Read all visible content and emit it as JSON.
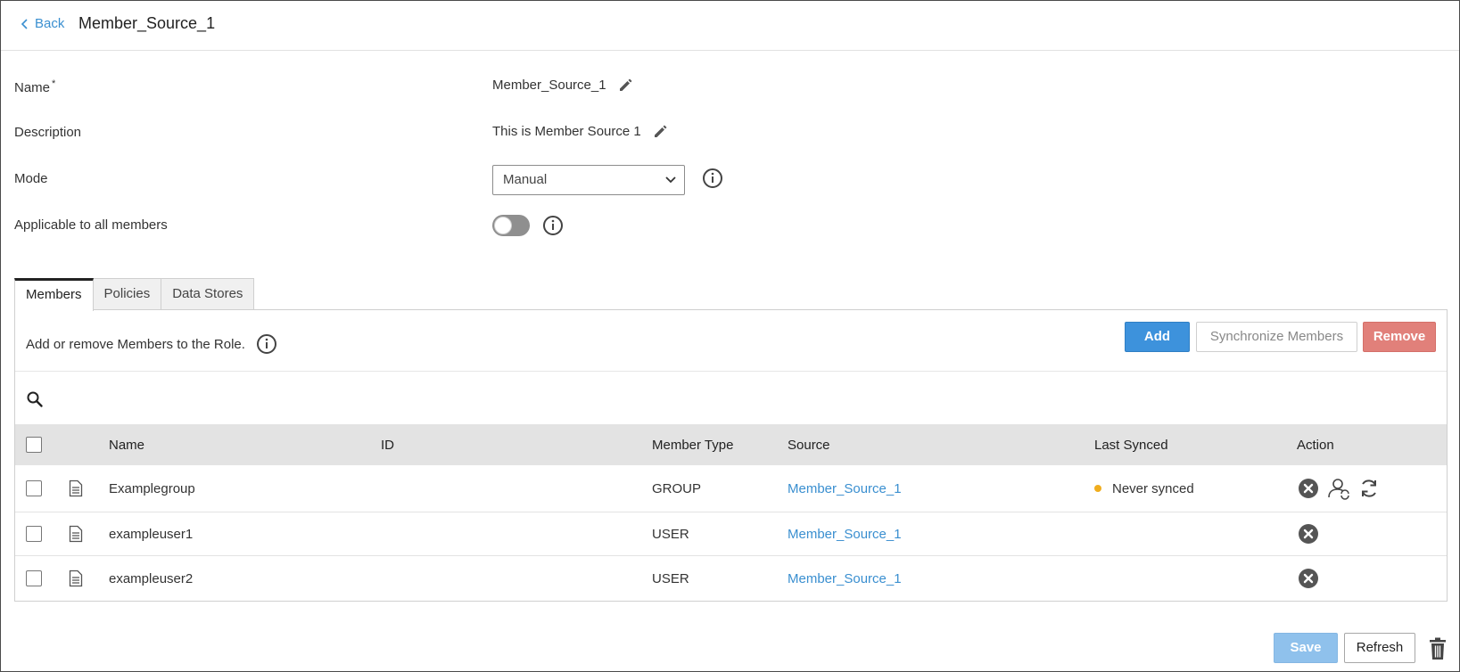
{
  "header": {
    "back_label": "Back",
    "title": "Member_Source_1"
  },
  "form": {
    "name_label": "Name",
    "name_required_mark": "*",
    "name_value": "Member_Source_1",
    "description_label": "Description",
    "description_value": "This is Member Source 1",
    "mode_label": "Mode",
    "mode_value": "Manual",
    "applicable_label": "Applicable to all members",
    "applicable_enabled": false
  },
  "tabs": [
    {
      "label": "Members",
      "active": true
    },
    {
      "label": "Policies",
      "active": false
    },
    {
      "label": "Data Stores",
      "active": false
    }
  ],
  "members_panel": {
    "description": "Add or remove Members to the Role.",
    "add_label": "Add",
    "sync_label": "Synchronize Members",
    "remove_label": "Remove"
  },
  "table": {
    "columns": [
      "Name",
      "ID",
      "Member Type",
      "Source",
      "Last Synced",
      "Action"
    ],
    "rows": [
      {
        "name": "Examplegroup",
        "id": "",
        "type": "GROUP",
        "source": "Member_Source_1",
        "last_synced": "Never synced",
        "actions": [
          "remove-icon",
          "user-sync-icon",
          "refresh-icon"
        ]
      },
      {
        "name": "exampleuser1",
        "id": "",
        "type": "USER",
        "source": "Member_Source_1",
        "last_synced": "",
        "actions": [
          "remove-icon"
        ]
      },
      {
        "name": "exampleuser2",
        "id": "",
        "type": "USER",
        "source": "Member_Source_1",
        "last_synced": "",
        "actions": [
          "remove-icon"
        ]
      }
    ]
  },
  "footer": {
    "save_label": "Save",
    "refresh_label": "Refresh"
  },
  "colors": {
    "primary": "#3d92dc",
    "danger": "#e1807a",
    "link": "#3a8fd0",
    "warning_dot": "#f0ad1e"
  }
}
